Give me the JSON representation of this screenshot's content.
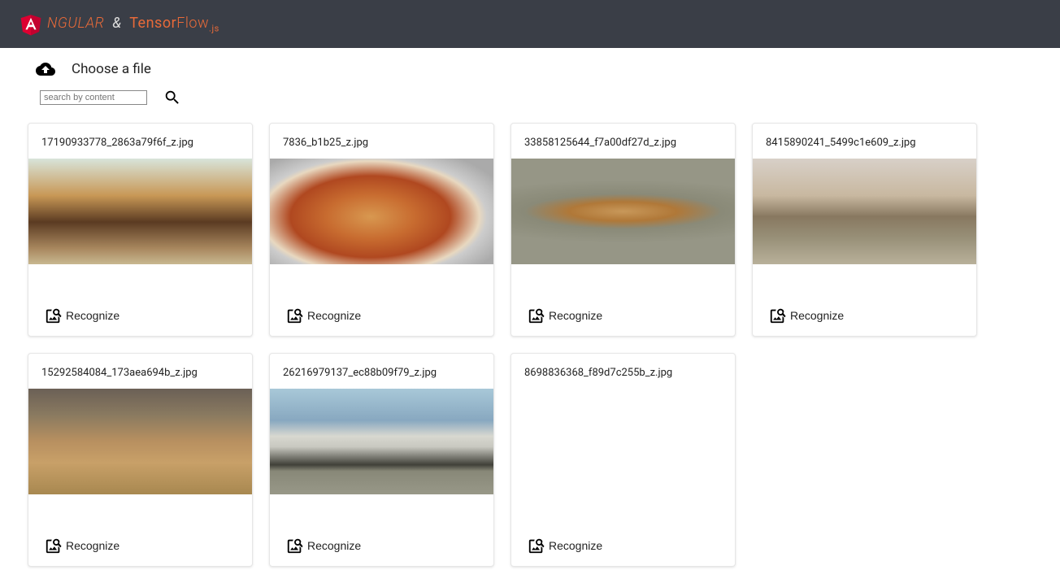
{
  "header": {
    "brand_angular": "NGULAR",
    "brand_amp": "&",
    "brand_tensor": "Tensor",
    "brand_flow": "Flow",
    "brand_js": ".js"
  },
  "controls": {
    "choose_file_label": "Choose a file",
    "search_placeholder": "search by content"
  },
  "recognize_label": "Recognize",
  "cards": [
    {
      "filename": "17190933778_2863a79f6f_z.jpg",
      "thumb": "thumb-hotdog"
    },
    {
      "filename": "7836_b1b25_z.jpg",
      "thumb": "thumb-pizza"
    },
    {
      "filename": "33858125644_f7a00df27d_z.jpg",
      "thumb": "thumb-banana"
    },
    {
      "filename": "8415890241_5499c1e609_z.jpg",
      "thumb": "thumb-kittens"
    },
    {
      "filename": "15292584084_173aea694b_z.jpg",
      "thumb": "thumb-stilllife"
    },
    {
      "filename": "26216979137_ec88b09f79_z.jpg",
      "thumb": "thumb-bicycle"
    },
    {
      "filename": "8698836368_f89d7c255b_z.jpg",
      "thumb": "thumb-blank"
    }
  ]
}
